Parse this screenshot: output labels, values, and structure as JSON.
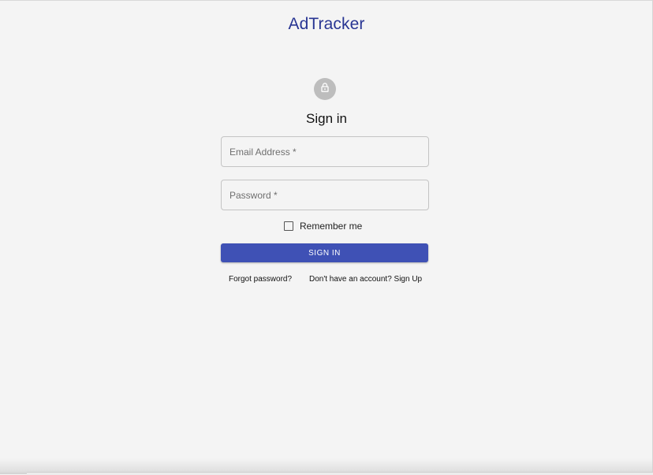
{
  "app": {
    "brand": "AdTracker"
  },
  "form": {
    "heading": "Sign in",
    "icon": "lock-icon",
    "email_placeholder": "Email Address *",
    "password_placeholder": "Password *",
    "remember_label": "Remember me",
    "remember_checked": false,
    "submit_label": "SIGN IN"
  },
  "links": {
    "forgot": "Forgot password?",
    "signup": "Don't have an account? Sign Up"
  },
  "colors": {
    "brand": "#283593",
    "button": "#3f51b5",
    "avatar": "#bdbdbd",
    "background": "#f4f4f4"
  }
}
